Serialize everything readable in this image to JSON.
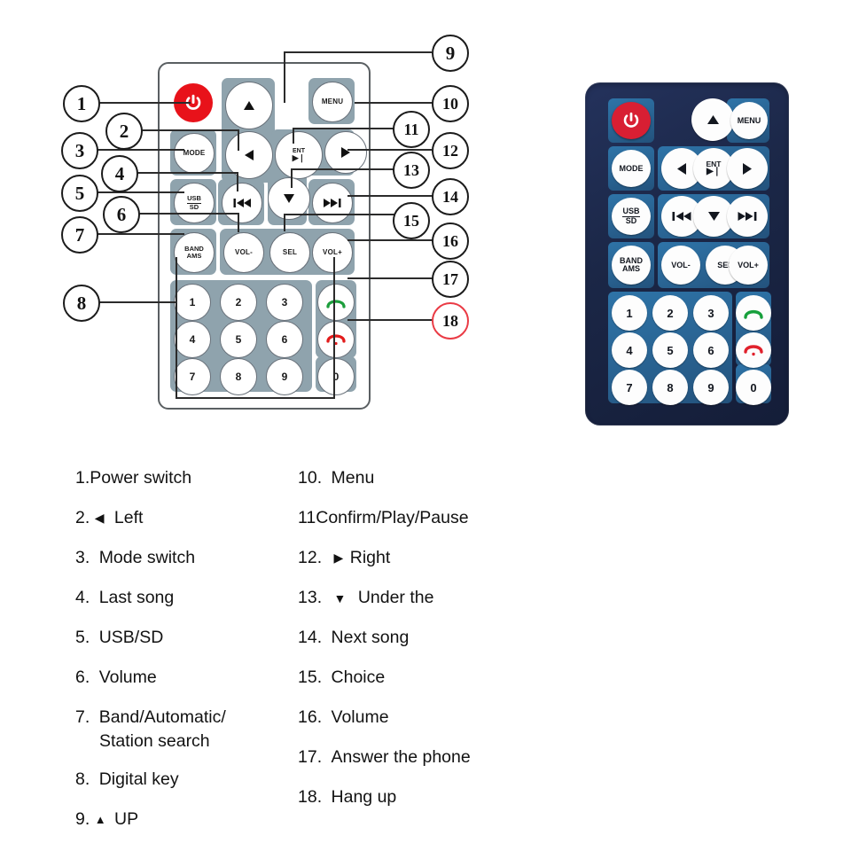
{
  "diagram": {
    "title_present": false,
    "left_remote": {
      "name": "line-art-remote-diagram",
      "keys": [
        {
          "id": "power",
          "label": "",
          "icon": "power-icon"
        },
        {
          "id": "up",
          "label": "",
          "icon": "triangle-up-icon"
        },
        {
          "id": "menu",
          "label": "MENU",
          "icon": ""
        },
        {
          "id": "mode",
          "label": "MODE",
          "icon": ""
        },
        {
          "id": "left",
          "label": "",
          "icon": "triangle-left-icon"
        },
        {
          "id": "ent",
          "label": "ENT",
          "label2": "▶❘",
          "icon": "play-pause-icon"
        },
        {
          "id": "right",
          "label": "",
          "icon": "triangle-right-icon"
        },
        {
          "id": "usbsd",
          "label": "USB",
          "label2": "SD",
          "icon": ""
        },
        {
          "id": "prev",
          "label": "",
          "icon": "previous-track-icon"
        },
        {
          "id": "down",
          "label": "",
          "icon": "triangle-down-icon"
        },
        {
          "id": "next",
          "label": "",
          "icon": "next-track-icon"
        },
        {
          "id": "bandams",
          "label": "BAND",
          "label2": "AMS",
          "icon": ""
        },
        {
          "id": "volminus",
          "label": "VOL-",
          "icon": ""
        },
        {
          "id": "sel",
          "label": "SEL",
          "icon": ""
        },
        {
          "id": "volplus",
          "label": "VOL+",
          "icon": ""
        },
        {
          "id": "answer",
          "label": "",
          "icon": "phone-answer-icon"
        },
        {
          "id": "hangup",
          "label": "",
          "icon": "phone-hangup-icon"
        }
      ],
      "digits": [
        "1",
        "2",
        "3",
        "4",
        "5",
        "6",
        "7",
        "8",
        "9",
        "0"
      ]
    },
    "right_remote": {
      "name": "photo-remote",
      "body_color": "#1b2747",
      "plate_color": "#2a6696",
      "power_color": "#d81f33"
    },
    "callouts": [
      {
        "n": "1"
      },
      {
        "n": "2"
      },
      {
        "n": "3"
      },
      {
        "n": "4"
      },
      {
        "n": "5"
      },
      {
        "n": "6"
      },
      {
        "n": "7"
      },
      {
        "n": "8"
      },
      {
        "n": "9"
      },
      {
        "n": "10"
      },
      {
        "n": "11"
      },
      {
        "n": "12"
      },
      {
        "n": "13"
      },
      {
        "n": "14"
      },
      {
        "n": "15"
      },
      {
        "n": "16"
      },
      {
        "n": "17"
      },
      {
        "n": "18"
      }
    ]
  },
  "legend": {
    "left_column": [
      {
        "num": "1.",
        "text": "Power switch",
        "glyph": ""
      },
      {
        "num": "2.",
        "text": "Left",
        "glyph": "◀"
      },
      {
        "num": "3.",
        "text": "Mode switch",
        "glyph": ""
      },
      {
        "num": "4.",
        "text": "Last song",
        "glyph": ""
      },
      {
        "num": "5.",
        "text": "USB/SD",
        "glyph": ""
      },
      {
        "num": "6.",
        "text": "Volume",
        "glyph": ""
      },
      {
        "num": "7.",
        "text": "Band/Automatic/",
        "glyph": "",
        "text2": "Station search"
      },
      {
        "num": "8.",
        "text": "Digital key",
        "glyph": ""
      },
      {
        "num": "9.",
        "text": "UP",
        "glyph": "▲"
      }
    ],
    "right_column": [
      {
        "num": "10.",
        "text": "Menu",
        "glyph": ""
      },
      {
        "num": "11",
        "text": "Confirm/Play/Pause",
        "glyph": ""
      },
      {
        "num": "12.",
        "text": "Right",
        "glyph": "▶"
      },
      {
        "num": "13.",
        "text": "Under the",
        "glyph": "▼"
      },
      {
        "num": "14.",
        "text": "Next song",
        "glyph": ""
      },
      {
        "num": "15.",
        "text": "Choice",
        "glyph": ""
      },
      {
        "num": "16.",
        "text": "Volume",
        "glyph": ""
      },
      {
        "num": "17.",
        "text": "Answer the phone",
        "glyph": ""
      },
      {
        "num": "18.",
        "text": "Hang up",
        "glyph": ""
      }
    ]
  },
  "colors": {
    "power_red": "#e8121a",
    "plate_grey": "#8fa3ad",
    "outline": "#5a5f62",
    "answer_green": "#1c9e3c",
    "hangup_red": "#e21b1b",
    "callout_highlight": "#ea3b45"
  }
}
